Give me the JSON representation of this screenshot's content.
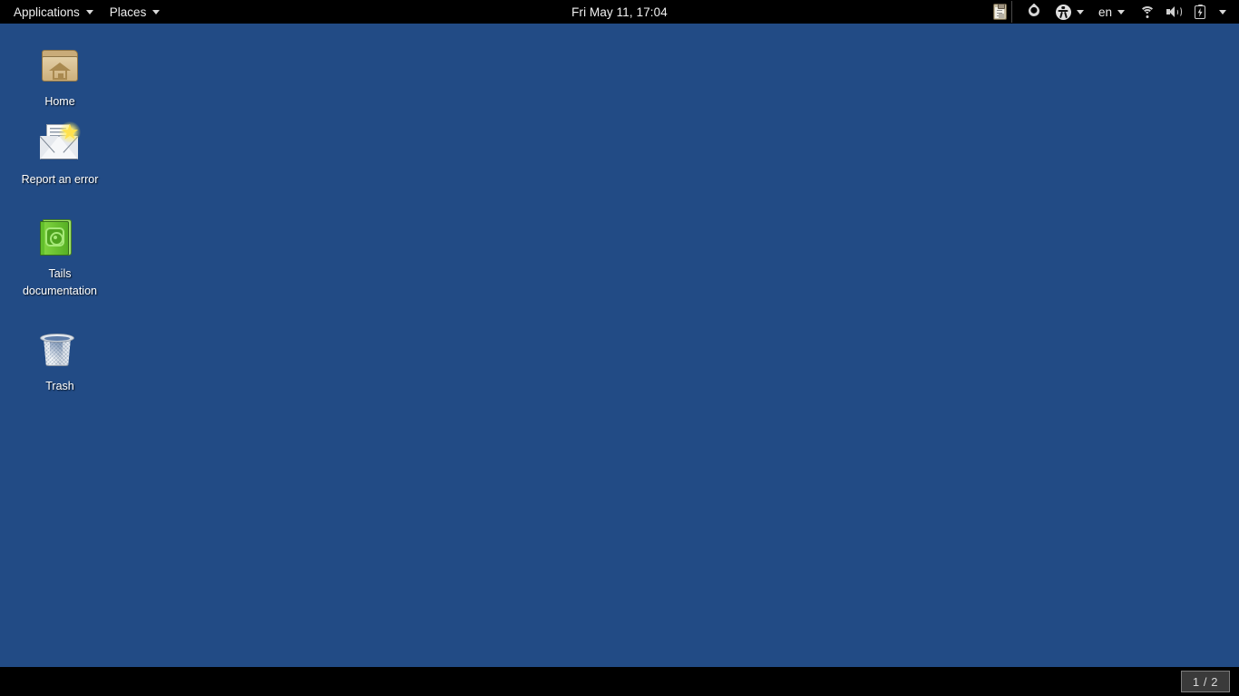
{
  "top_panel": {
    "menus": [
      {
        "label": "Applications",
        "icon": "chevron-down-icon"
      },
      {
        "label": "Places",
        "icon": "chevron-down-icon"
      }
    ],
    "clock": "Fri May 11, 17:04",
    "tray": {
      "clipboard_icon": "clipboard-icon",
      "tor_icon": "onion-droplet-icon",
      "accessibility_icon": "universal-access-icon",
      "keyboard_layout": "en",
      "wifi_icon": "wifi-icon",
      "volume_icon": "volume-icon",
      "battery_icon": "battery-charging-icon",
      "system_menu_icon": "chevron-down-icon"
    }
  },
  "desktop": {
    "background_color": "#224b85",
    "icons": [
      {
        "label": "Home",
        "icon": "home-folder-icon"
      },
      {
        "label": "Report an error",
        "icon": "mail-star-icon"
      },
      {
        "label": "Tails documentation",
        "icon": "green-book-icon"
      },
      {
        "label": "Trash",
        "icon": "trash-icon"
      }
    ]
  },
  "bottom_panel": {
    "workspace_indicator": "1 / 2",
    "background_color": "#000000"
  }
}
